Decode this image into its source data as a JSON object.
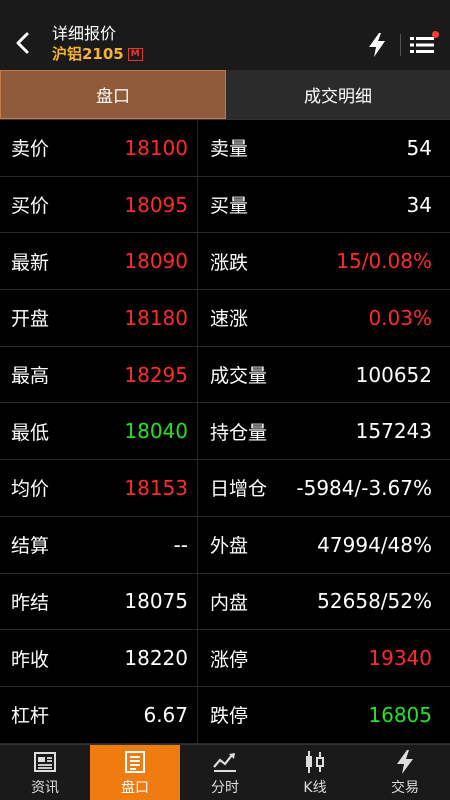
{
  "header": {
    "title": "详细报价",
    "subtitle": "沪铝2105",
    "badge": "M"
  },
  "tabs": [
    {
      "label": "盘口",
      "active": true
    },
    {
      "label": "成交明细",
      "active": false
    }
  ],
  "rows": [
    {
      "l1": "卖价",
      "v1": "18100",
      "c1": "red",
      "l2": "卖量",
      "v2": "54",
      "c2": "white"
    },
    {
      "l1": "买价",
      "v1": "18095",
      "c1": "red",
      "l2": "买量",
      "v2": "34",
      "c2": "white"
    },
    {
      "l1": "最新",
      "v1": "18090",
      "c1": "red",
      "l2": "涨跌",
      "v2": "15/0.08%",
      "c2": "red"
    },
    {
      "l1": "开盘",
      "v1": "18180",
      "c1": "red",
      "l2": "速涨",
      "v2": "0.03%",
      "c2": "red"
    },
    {
      "l1": "最高",
      "v1": "18295",
      "c1": "red",
      "l2": "成交量",
      "v2": "100652",
      "c2": "white"
    },
    {
      "l1": "最低",
      "v1": "18040",
      "c1": "green",
      "l2": "持仓量",
      "v2": "157243",
      "c2": "white"
    },
    {
      "l1": "均价",
      "v1": "18153",
      "c1": "red",
      "l2": "日增仓",
      "v2": "-5984/-3.67%",
      "c2": "white"
    },
    {
      "l1": "结算",
      "v1": "--",
      "c1": "white",
      "l2": "外盘",
      "v2": "47994/48%",
      "c2": "white"
    },
    {
      "l1": "昨结",
      "v1": "18075",
      "c1": "white",
      "l2": "内盘",
      "v2": "52658/52%",
      "c2": "white"
    },
    {
      "l1": "昨收",
      "v1": "18220",
      "c1": "white",
      "l2": "涨停",
      "v2": "19340",
      "c2": "red"
    },
    {
      "l1": "杠杆",
      "v1": "6.67",
      "c1": "white",
      "l2": "跌停",
      "v2": "16805",
      "c2": "green"
    }
  ],
  "nav": [
    {
      "label": "资讯",
      "icon": "news-icon",
      "active": false
    },
    {
      "label": "盘口",
      "icon": "orderbook-icon",
      "active": true
    },
    {
      "label": "分时",
      "icon": "timeshare-icon",
      "active": false
    },
    {
      "label": "K线",
      "icon": "kline-icon",
      "active": false
    },
    {
      "label": "交易",
      "icon": "trade-icon",
      "active": false
    }
  ],
  "colors": {
    "red": "#ff2a2a",
    "green": "#22e322",
    "accent": "#f07b10",
    "tab_active": "#8f5a3a",
    "subtitle": "#f6b233"
  }
}
